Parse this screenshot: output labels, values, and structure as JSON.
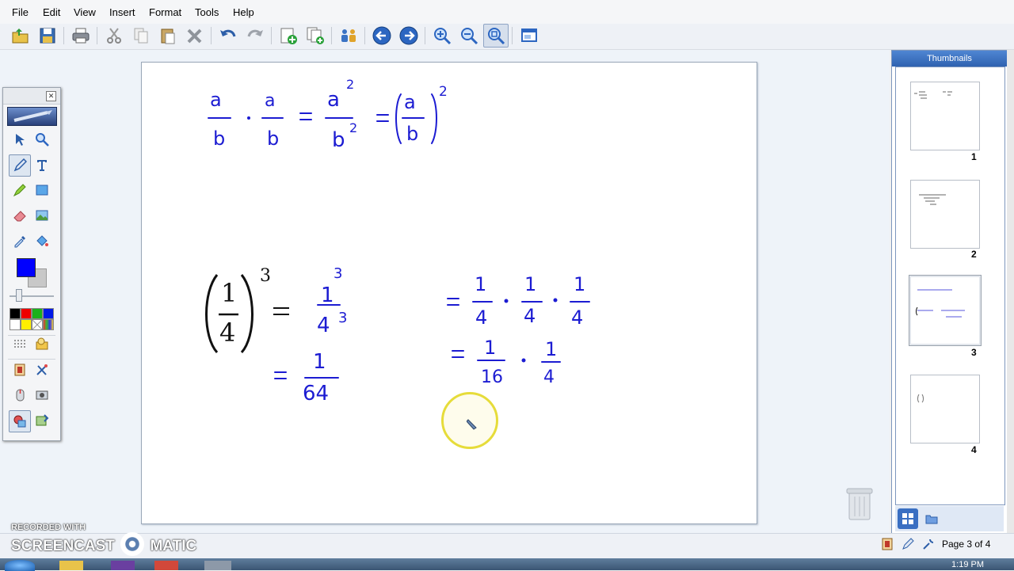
{
  "menu": [
    "File",
    "Edit",
    "View",
    "Insert",
    "Format",
    "Tools",
    "Help"
  ],
  "toolbar": {
    "icons": [
      "open-icon",
      "save-icon",
      "print-icon",
      "cut-icon",
      "copy-icon",
      "paste-icon",
      "delete-icon",
      "undo-icon",
      "redo-icon",
      "add-page-icon",
      "duplicate-page-icon",
      "share-icon",
      "previous-page-icon",
      "next-page-icon",
      "zoom-in-icon",
      "zoom-out-icon",
      "zoom-fit-icon",
      "screen-icon"
    ]
  },
  "palette": {
    "close_label": "✕",
    "pen_color": "#0000ff",
    "swatches": [
      "#000000",
      "#ff0000",
      "#00aa00",
      "#0000ff",
      "#ffffff",
      "#ffff00",
      "#transparent",
      "#multicolor"
    ]
  },
  "canvas": {
    "ink_color": "#1c1cd2"
  },
  "thumbnails": {
    "title": "Thumbnails",
    "pages": [
      "1",
      "2",
      "3",
      "4"
    ],
    "selected": 3
  },
  "status": {
    "page_text": "Page 3 of 4"
  },
  "watermark": {
    "line1": "RECORDED WITH",
    "line2": "SCREENCAST",
    "line3": "MATIC"
  },
  "taskbar": {
    "clock": "1:19 PM"
  }
}
